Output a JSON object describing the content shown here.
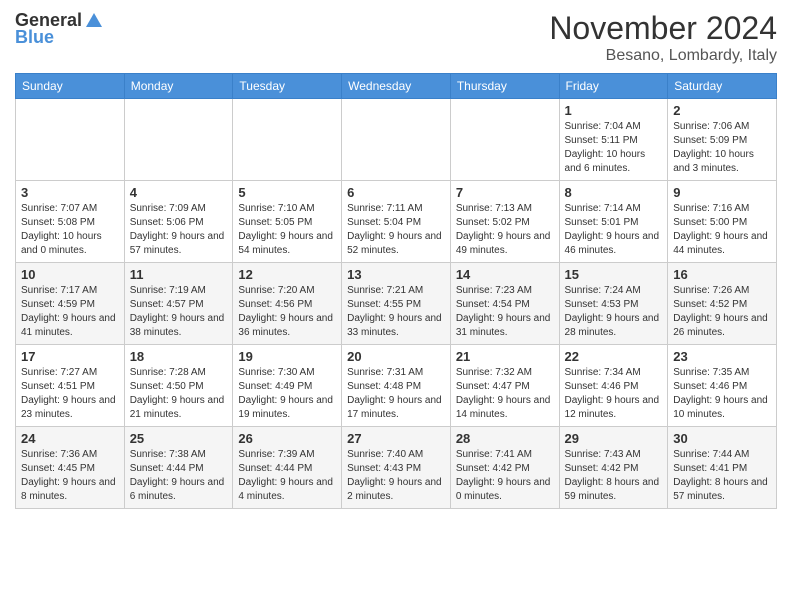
{
  "header": {
    "logo_general": "General",
    "logo_blue": "Blue",
    "month_title": "November 2024",
    "location": "Besano, Lombardy, Italy"
  },
  "days_of_week": [
    "Sunday",
    "Monday",
    "Tuesday",
    "Wednesday",
    "Thursday",
    "Friday",
    "Saturday"
  ],
  "weeks": [
    [
      {
        "day": "",
        "info": ""
      },
      {
        "day": "",
        "info": ""
      },
      {
        "day": "",
        "info": ""
      },
      {
        "day": "",
        "info": ""
      },
      {
        "day": "",
        "info": ""
      },
      {
        "day": "1",
        "info": "Sunrise: 7:04 AM\nSunset: 5:11 PM\nDaylight: 10 hours and 6 minutes."
      },
      {
        "day": "2",
        "info": "Sunrise: 7:06 AM\nSunset: 5:09 PM\nDaylight: 10 hours and 3 minutes."
      }
    ],
    [
      {
        "day": "3",
        "info": "Sunrise: 7:07 AM\nSunset: 5:08 PM\nDaylight: 10 hours and 0 minutes."
      },
      {
        "day": "4",
        "info": "Sunrise: 7:09 AM\nSunset: 5:06 PM\nDaylight: 9 hours and 57 minutes."
      },
      {
        "day": "5",
        "info": "Sunrise: 7:10 AM\nSunset: 5:05 PM\nDaylight: 9 hours and 54 minutes."
      },
      {
        "day": "6",
        "info": "Sunrise: 7:11 AM\nSunset: 5:04 PM\nDaylight: 9 hours and 52 minutes."
      },
      {
        "day": "7",
        "info": "Sunrise: 7:13 AM\nSunset: 5:02 PM\nDaylight: 9 hours and 49 minutes."
      },
      {
        "day": "8",
        "info": "Sunrise: 7:14 AM\nSunset: 5:01 PM\nDaylight: 9 hours and 46 minutes."
      },
      {
        "day": "9",
        "info": "Sunrise: 7:16 AM\nSunset: 5:00 PM\nDaylight: 9 hours and 44 minutes."
      }
    ],
    [
      {
        "day": "10",
        "info": "Sunrise: 7:17 AM\nSunset: 4:59 PM\nDaylight: 9 hours and 41 minutes."
      },
      {
        "day": "11",
        "info": "Sunrise: 7:19 AM\nSunset: 4:57 PM\nDaylight: 9 hours and 38 minutes."
      },
      {
        "day": "12",
        "info": "Sunrise: 7:20 AM\nSunset: 4:56 PM\nDaylight: 9 hours and 36 minutes."
      },
      {
        "day": "13",
        "info": "Sunrise: 7:21 AM\nSunset: 4:55 PM\nDaylight: 9 hours and 33 minutes."
      },
      {
        "day": "14",
        "info": "Sunrise: 7:23 AM\nSunset: 4:54 PM\nDaylight: 9 hours and 31 minutes."
      },
      {
        "day": "15",
        "info": "Sunrise: 7:24 AM\nSunset: 4:53 PM\nDaylight: 9 hours and 28 minutes."
      },
      {
        "day": "16",
        "info": "Sunrise: 7:26 AM\nSunset: 4:52 PM\nDaylight: 9 hours and 26 minutes."
      }
    ],
    [
      {
        "day": "17",
        "info": "Sunrise: 7:27 AM\nSunset: 4:51 PM\nDaylight: 9 hours and 23 minutes."
      },
      {
        "day": "18",
        "info": "Sunrise: 7:28 AM\nSunset: 4:50 PM\nDaylight: 9 hours and 21 minutes."
      },
      {
        "day": "19",
        "info": "Sunrise: 7:30 AM\nSunset: 4:49 PM\nDaylight: 9 hours and 19 minutes."
      },
      {
        "day": "20",
        "info": "Sunrise: 7:31 AM\nSunset: 4:48 PM\nDaylight: 9 hours and 17 minutes."
      },
      {
        "day": "21",
        "info": "Sunrise: 7:32 AM\nSunset: 4:47 PM\nDaylight: 9 hours and 14 minutes."
      },
      {
        "day": "22",
        "info": "Sunrise: 7:34 AM\nSunset: 4:46 PM\nDaylight: 9 hours and 12 minutes."
      },
      {
        "day": "23",
        "info": "Sunrise: 7:35 AM\nSunset: 4:46 PM\nDaylight: 9 hours and 10 minutes."
      }
    ],
    [
      {
        "day": "24",
        "info": "Sunrise: 7:36 AM\nSunset: 4:45 PM\nDaylight: 9 hours and 8 minutes."
      },
      {
        "day": "25",
        "info": "Sunrise: 7:38 AM\nSunset: 4:44 PM\nDaylight: 9 hours and 6 minutes."
      },
      {
        "day": "26",
        "info": "Sunrise: 7:39 AM\nSunset: 4:44 PM\nDaylight: 9 hours and 4 minutes."
      },
      {
        "day": "27",
        "info": "Sunrise: 7:40 AM\nSunset: 4:43 PM\nDaylight: 9 hours and 2 minutes."
      },
      {
        "day": "28",
        "info": "Sunrise: 7:41 AM\nSunset: 4:42 PM\nDaylight: 9 hours and 0 minutes."
      },
      {
        "day": "29",
        "info": "Sunrise: 7:43 AM\nSunset: 4:42 PM\nDaylight: 8 hours and 59 minutes."
      },
      {
        "day": "30",
        "info": "Sunrise: 7:44 AM\nSunset: 4:41 PM\nDaylight: 8 hours and 57 minutes."
      }
    ]
  ]
}
